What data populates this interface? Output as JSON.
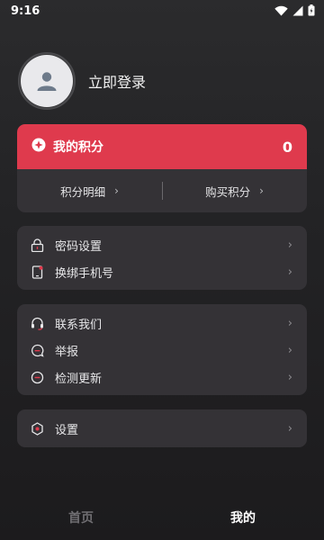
{
  "status_bar": {
    "time": "9:16"
  },
  "profile": {
    "login_label": "立即登录"
  },
  "points": {
    "label": "我的积分",
    "value": "0",
    "detail_link": "积分明细",
    "buy_link": "购买积分"
  },
  "security_menu": {
    "items": [
      {
        "label": "密码设置",
        "icon": "lock-icon"
      },
      {
        "label": "换绑手机号",
        "icon": "phone-icon"
      }
    ]
  },
  "contact_menu": {
    "items": [
      {
        "label": "联系我们",
        "icon": "headset-icon"
      },
      {
        "label": "举报",
        "icon": "report-icon"
      },
      {
        "label": "检测更新",
        "icon": "update-icon"
      }
    ]
  },
  "settings_menu": {
    "items": [
      {
        "label": "设置",
        "icon": "settings-icon"
      }
    ]
  },
  "bottom_nav": {
    "tabs": [
      {
        "label": "首页",
        "active": false
      },
      {
        "label": "我的",
        "active": true
      }
    ]
  },
  "colors": {
    "accent": "#df3a4d",
    "card_bg": "#343236",
    "page_bg": "#232325"
  }
}
